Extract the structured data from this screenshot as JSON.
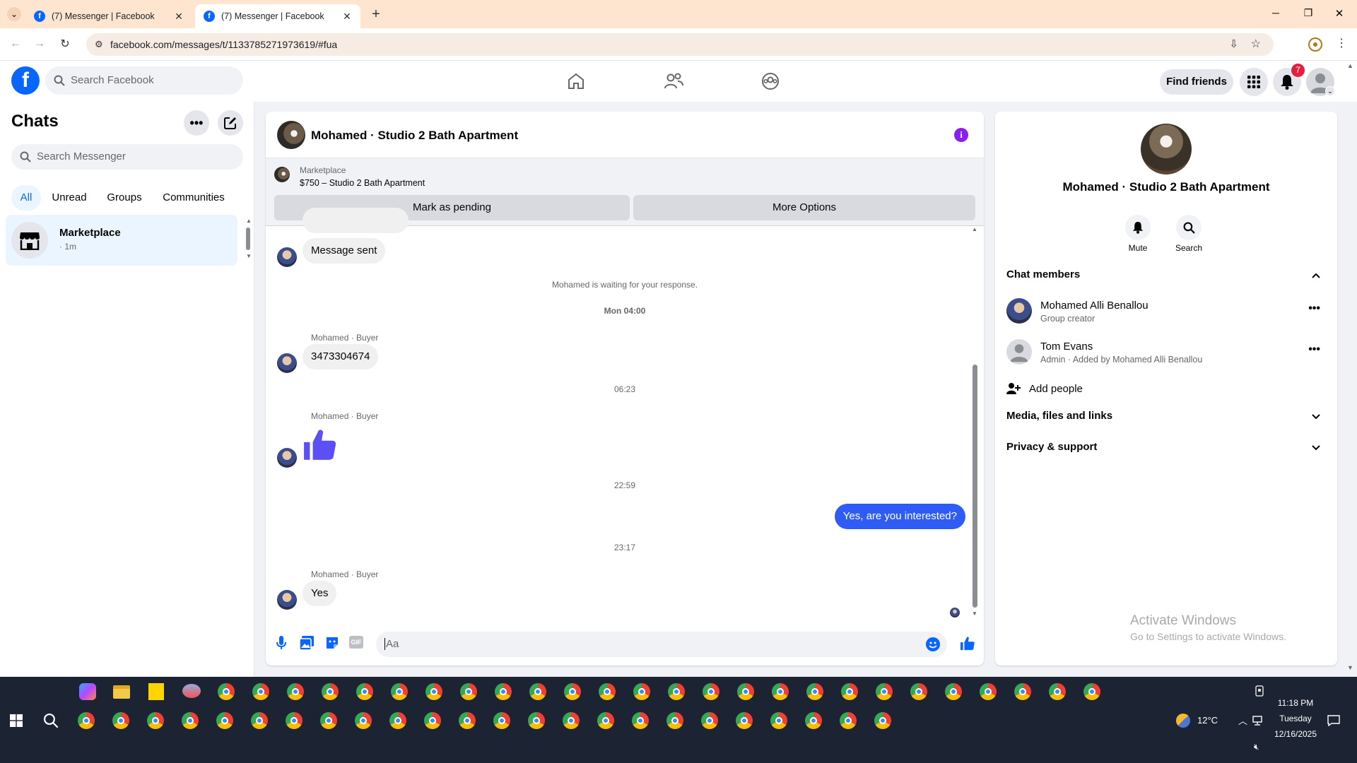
{
  "browser": {
    "tabs": [
      {
        "title": "(7) Messenger | Facebook"
      },
      {
        "title": "(7) Messenger | Facebook"
      }
    ],
    "url": "facebook.com/messages/t/1133785271973619/#fua"
  },
  "fb_nav": {
    "search_placeholder": "Search Facebook",
    "find_friends": "Find friends",
    "notification_count": "7"
  },
  "chats": {
    "title": "Chats",
    "search_placeholder": "Search Messenger",
    "filters": [
      "All",
      "Unread",
      "Groups",
      "Communities"
    ],
    "list": [
      {
        "name": "Marketplace",
        "sub": "· 1m"
      }
    ]
  },
  "conversation": {
    "title": "Mohamed · Studio 2 Bath Apartment",
    "listing_label": "Marketplace",
    "listing_title": "$750 – Studio 2 Bath Apartment",
    "mark_pending": "Mark as pending",
    "more_options": "More Options",
    "messages": {
      "sent_notice": "Message sent",
      "waiting": "Mohamed is waiting for your response.",
      "ts1": "Mon 04:00",
      "sender1": "Mohamed · Buyer",
      "msg1": "3473304674",
      "ts2": "06:23",
      "sender2": "Mohamed · Buyer",
      "ts3": "22:59",
      "outgoing": "Yes, are you interested?",
      "ts4": "23:17",
      "sender3": "Mohamed · Buyer",
      "msg3": "Yes"
    },
    "composer_placeholder": "Aa"
  },
  "info_panel": {
    "name": "Mohamed · Studio 2 Bath Apartment",
    "mute": "Mute",
    "search": "Search",
    "chat_members_label": "Chat members",
    "members": [
      {
        "name": "Mohamed Alli Benallou",
        "role": "Group creator"
      },
      {
        "name": "Tom Evans",
        "role": "Admin · Added by Mohamed Alli Benallou"
      }
    ],
    "add_people": "Add people",
    "media_label": "Media, files and links",
    "privacy_label": "Privacy & support"
  },
  "watermark": {
    "title": "Activate Windows",
    "sub": "Go to Settings to activate Windows."
  },
  "taskbar": {
    "weather": "12°C",
    "time": "11:18 PM",
    "day": "Tuesday",
    "date": "12/16/2025"
  },
  "colors": {
    "fb_blue": "#0866ff",
    "messenger_purple": "#6b4cf6",
    "tab_bar": "#fde5cf",
    "selected_chat": "#ebf5ff"
  }
}
